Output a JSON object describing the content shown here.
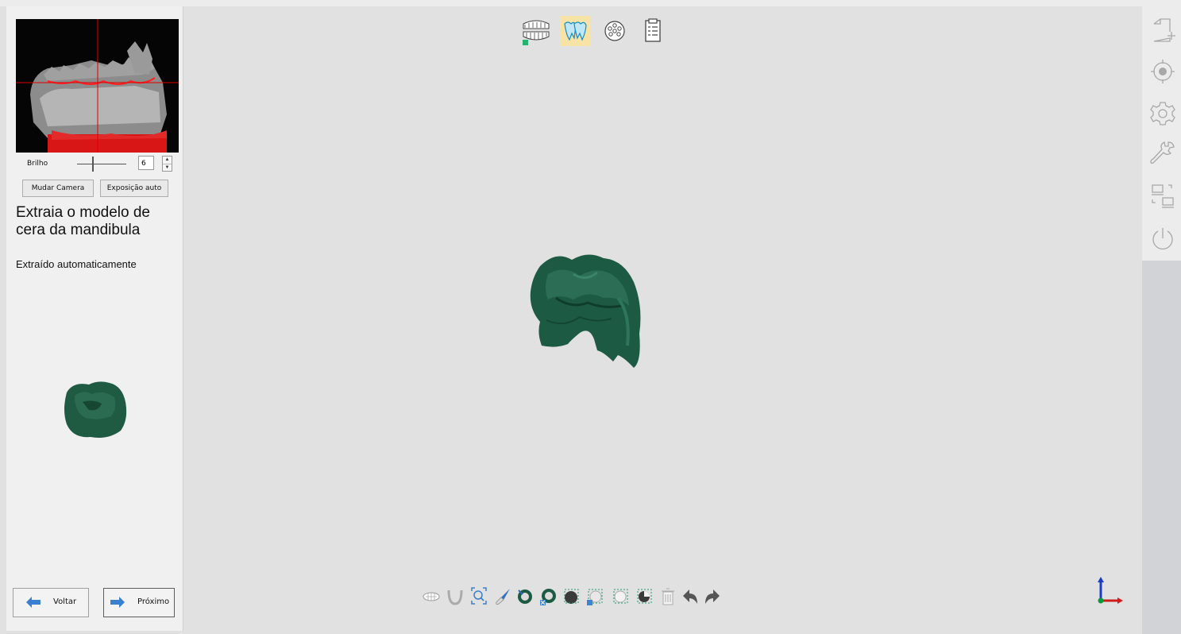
{
  "camera": {
    "brightness_label": "Brilho",
    "brightness_value": "6",
    "brightness_level": 0.5,
    "change_camera_label": "Mudar Camera",
    "auto_exposure_label": "Exposição auto"
  },
  "step": {
    "title": "Extraia o modelo de cera da mandibula",
    "subtitle": "Extraído automaticamente"
  },
  "nav": {
    "back_label": "Voltar",
    "next_label": "Próximo"
  },
  "top_toolbar": [
    {
      "icon": "jaws-icon",
      "active": false
    },
    {
      "icon": "teeth-icon",
      "active": true
    },
    {
      "icon": "dot-circle-icon",
      "active": false
    },
    {
      "icon": "clipboard-icon",
      "active": false
    }
  ],
  "bottom_toolbar": [
    "teeth-side-icon",
    "arch-icon",
    "zoom-fit-icon",
    "brush-icon",
    "select-include-icon",
    "select-exclude-icon",
    "region-select-icon",
    "region-deselect-icon",
    "lasso-icon",
    "crop-icon",
    "trash-icon",
    "undo-icon",
    "redo-icon"
  ],
  "right_sidebar": [
    "new-file-icon",
    "target-icon",
    "gear-icon",
    "wrench-icon",
    "display-switch-icon",
    "power-icon"
  ],
  "colors": {
    "model_green": "#1d5a44",
    "active_tool": "#f7e3a6",
    "viewport_bg": "#e1e1e1",
    "arrow_blue": "#3b7fd1"
  }
}
